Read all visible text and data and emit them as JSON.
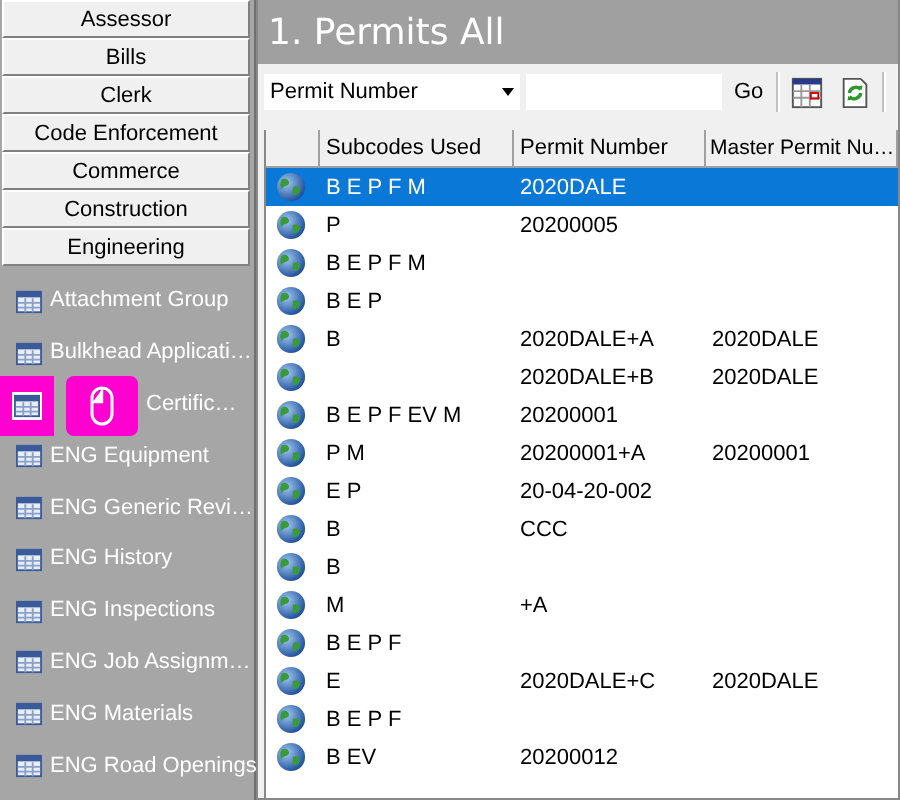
{
  "modules": [
    {
      "label": "Assessor"
    },
    {
      "label": "Bills"
    },
    {
      "label": "Clerk"
    },
    {
      "label": "Code Enforcement"
    },
    {
      "label": "Commerce"
    },
    {
      "label": "Construction"
    },
    {
      "label": "Engineering"
    }
  ],
  "items": [
    {
      "label": "Attachment Group",
      "kind": "plain"
    },
    {
      "label": "Bulkhead Applicati…",
      "kind": "plain"
    },
    {
      "label": "Certific…",
      "kind": "highlighted"
    },
    {
      "label": "ENG Equipment",
      "kind": "plain"
    },
    {
      "label": "ENG Generic Revi…",
      "kind": "plain"
    },
    {
      "label": "ENG History",
      "kind": "plain"
    },
    {
      "label": "ENG Inspections",
      "kind": "plain"
    },
    {
      "label": "ENG Job Assignm…",
      "kind": "plain"
    },
    {
      "label": "ENG Materials",
      "kind": "plain"
    },
    {
      "label": "ENG Road Openings",
      "kind": "plain"
    }
  ],
  "title": "1. Permits All",
  "toolbar": {
    "search_by": "Permit Number",
    "go": "Go"
  },
  "table": {
    "columns": [
      "Subcodes Used",
      "Permit Number",
      "Master Permit Nu…"
    ],
    "rows": [
      {
        "cells": [
          "B E P F M",
          "2020DALE",
          ""
        ],
        "selected": true
      },
      {
        "cells": [
          "P",
          "20200005",
          ""
        ],
        "selected": false
      },
      {
        "cells": [
          "B E P F M",
          "",
          ""
        ],
        "selected": false
      },
      {
        "cells": [
          "B E P",
          "",
          ""
        ],
        "selected": false
      },
      {
        "cells": [
          "B",
          "2020DALE+A",
          "2020DALE"
        ],
        "selected": false
      },
      {
        "cells": [
          "",
          "2020DALE+B",
          "2020DALE"
        ],
        "selected": false
      },
      {
        "cells": [
          "B E P F EV M",
          "20200001",
          ""
        ],
        "selected": false
      },
      {
        "cells": [
          "P M",
          "20200001+A",
          "20200001"
        ],
        "selected": false
      },
      {
        "cells": [
          "E P",
          "20-04-20-002",
          ""
        ],
        "selected": false
      },
      {
        "cells": [
          "B",
          "CCC",
          ""
        ],
        "selected": false
      },
      {
        "cells": [
          "B",
          "",
          ""
        ],
        "selected": false
      },
      {
        "cells": [
          "M",
          "+A",
          ""
        ],
        "selected": false
      },
      {
        "cells": [
          "B E P F",
          "",
          ""
        ],
        "selected": false
      },
      {
        "cells": [
          "E",
          "2020DALE+C",
          "2020DALE"
        ],
        "selected": false
      },
      {
        "cells": [
          "B E P F",
          "",
          ""
        ],
        "selected": false
      },
      {
        "cells": [
          "B EV",
          "20200012",
          ""
        ],
        "selected": false
      }
    ]
  }
}
